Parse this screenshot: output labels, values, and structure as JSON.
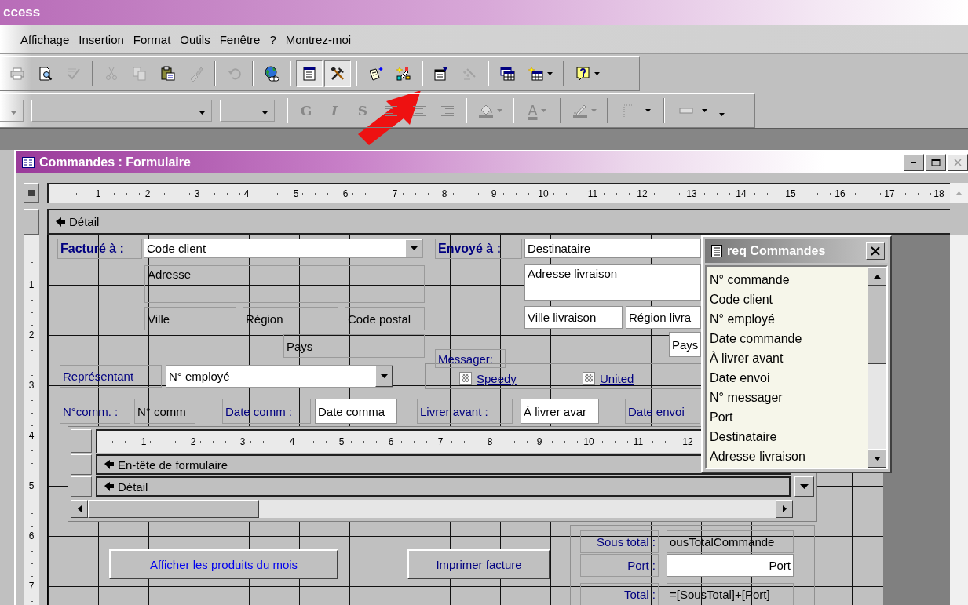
{
  "app": {
    "title": "ccess"
  },
  "menu": [
    "Affichage",
    "Insertion",
    "Format",
    "Outils",
    "Fenêtre",
    "?",
    "Montrez-moi"
  ],
  "toolbar_1": [
    {
      "pressed": false,
      "disabled": false,
      "dropdown": false
    },
    {
      "pressed": false,
      "disabled": false,
      "dropdown": false
    },
    {
      "pressed": false,
      "disabled": true,
      "dropdown": false
    },
    {
      "pressed": false,
      "disabled": true,
      "dropdown": false
    },
    {
      "pressed": false,
      "disabled": true,
      "dropdown": false
    },
    {
      "pressed": false,
      "disabled": false,
      "dropdown": false
    },
    {
      "pressed": false,
      "disabled": true,
      "dropdown": false
    },
    {
      "pressed": false,
      "disabled": true,
      "dropdown": false
    },
    {
      "pressed": false,
      "disabled": false,
      "dropdown": false
    },
    {
      "pressed": true,
      "disabled": false,
      "dropdown": false
    },
    {
      "pressed": true,
      "disabled": false,
      "dropdown": false
    },
    {
      "pressed": false,
      "disabled": false,
      "dropdown": false
    },
    {
      "pressed": false,
      "disabled": false,
      "dropdown": false
    },
    {
      "pressed": false,
      "disabled": false,
      "dropdown": false
    },
    {
      "pressed": false,
      "disabled": true,
      "dropdown": false
    },
    {
      "pressed": false,
      "disabled": false,
      "dropdown": false
    },
    {
      "pressed": false,
      "disabled": false,
      "dropdown": true
    },
    {
      "pressed": false,
      "disabled": false,
      "dropdown": true
    }
  ],
  "toolbar_2": {
    "format_buttons": [
      "G",
      "I",
      "S"
    ],
    "font_color_glyph": "A"
  },
  "form_window": {
    "title": "Commandes : Formulaire",
    "ruler": [
      "1",
      "2",
      "3",
      "4",
      "5",
      "6",
      "7",
      "8",
      "9",
      "10",
      "11",
      "12",
      "13",
      "14",
      "15",
      "16",
      "17",
      "18"
    ],
    "section": "Détail",
    "vertical_ruler": [
      "1",
      "2",
      "3",
      "4",
      "5",
      "6",
      "7"
    ],
    "controls": [
      {
        "kind": "heading",
        "text": "Facturé à :",
        "underline": false
      },
      {
        "kind": "combo",
        "text": "Code client",
        "underline": false
      },
      {
        "kind": "heading",
        "text": "Envoyé à :",
        "underline": false
      },
      {
        "kind": "textbox",
        "text": "Destinataire",
        "underline": false
      },
      {
        "kind": "field",
        "text": "Adresse",
        "underline": false
      },
      {
        "kind": "textbox",
        "text": "Adresse livraison",
        "underline": false
      },
      {
        "kind": "field",
        "text": "Ville",
        "underline": false
      },
      {
        "kind": "field",
        "text": "Région",
        "underline": false
      },
      {
        "kind": "field",
        "text": "Code postal",
        "underline": false
      },
      {
        "kind": "textbox",
        "text": "Ville livraison",
        "underline": false
      },
      {
        "kind": "textbox",
        "text": "Région livra",
        "underline": false
      },
      {
        "kind": "field",
        "text": "Pays",
        "underline": false
      },
      {
        "kind": "textbox",
        "text": "Pays",
        "underline": false
      },
      {
        "kind": "label",
        "text": "Messager:",
        "underline": false
      },
      {
        "kind": "label",
        "text": "Représentant",
        "underline": false
      },
      {
        "kind": "combo",
        "text": "N° employé",
        "underline": false
      },
      {
        "kind": "option",
        "text": "Speedy",
        "underline": true
      },
      {
        "kind": "option",
        "text": "United",
        "underline": true
      },
      {
        "kind": "label",
        "text": "N°comm. :",
        "underline": false
      },
      {
        "kind": "field",
        "text": "N° comm",
        "underline": false
      },
      {
        "kind": "label",
        "text": "Date comm :",
        "underline": false
      },
      {
        "kind": "textbox",
        "text": "Date comma",
        "underline": false
      },
      {
        "kind": "label",
        "text": "Livrer avant :",
        "underline": false
      },
      {
        "kind": "textbox",
        "text": "À livrer avar",
        "underline": false
      },
      {
        "kind": "label",
        "text": "Date envoi",
        "underline": false
      },
      {
        "kind": "label",
        "text": "Sous total :",
        "underline": false
      },
      {
        "kind": "field",
        "text": "ousTotalCommande",
        "underline": false
      },
      {
        "kind": "button",
        "text": "Afficher les produits du mois",
        "underline": true
      },
      {
        "kind": "button",
        "text": "Imprimer facture",
        "underline": false
      },
      {
        "kind": "label",
        "text": "Port :",
        "underline": false
      },
      {
        "kind": "textbox",
        "text": "Port",
        "underline": false
      },
      {
        "kind": "label",
        "text": "Total :",
        "underline": false
      },
      {
        "kind": "field",
        "text": "=[SousTotal]+[Port]",
        "underline": false
      }
    ],
    "subform": {
      "ruler": [
        "1",
        "2",
        "3",
        "4",
        "5",
        "6",
        "7",
        "8",
        "9",
        "10",
        "11",
        "12"
      ],
      "sections": [
        "En-tête de formulaire",
        "Détail"
      ]
    },
    "field_list": {
      "title": "req Commandes",
      "items": [
        "N° commande",
        "Code client",
        "N° employé",
        "Date commande",
        "À livrer avant",
        "Date envoi",
        "N° messager",
        "Port",
        "Destinataire",
        "Adresse livraison"
      ]
    }
  }
}
